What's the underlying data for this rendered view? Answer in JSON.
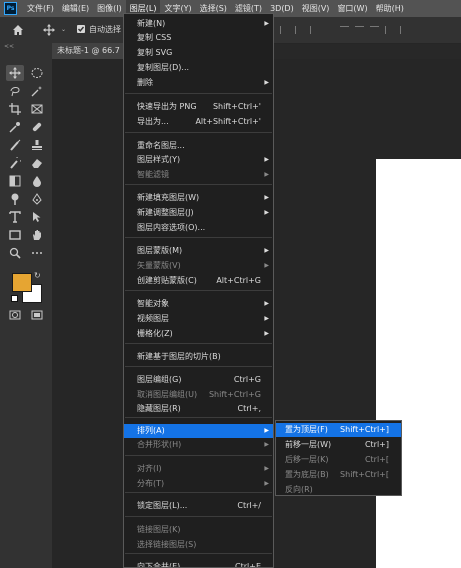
{
  "app": {
    "logo": "Ps"
  },
  "menubar": {
    "items": [
      "文件(F)",
      "编辑(E)",
      "图像(I)",
      "图层(L)",
      "文字(Y)",
      "选择(S)",
      "滤镜(T)",
      "3D(D)",
      "视图(V)",
      "窗口(W)",
      "帮助(H)"
    ]
  },
  "options_bar": {
    "auto_select_label": "自动选择",
    "collapse_glyph": "<<"
  },
  "document": {
    "tab_label": "未标题-1 @ 66.7"
  },
  "colors": {
    "foreground": "#e6a532",
    "background": "#ffffff",
    "highlight": "#1473e6"
  },
  "layer_menu": {
    "items": [
      {
        "label": "新建(N)",
        "submenu": true
      },
      {
        "label": "复制 CSS"
      },
      {
        "label": "复制 SVG"
      },
      {
        "label": "复制图层(D)..."
      },
      {
        "label": "删除",
        "submenu": true
      },
      {
        "label": "快速导出为 PNG",
        "shortcut": "Shift+Ctrl+'"
      },
      {
        "label": "导出为...",
        "shortcut": "Alt+Shift+Ctrl+'"
      },
      {
        "label": "重命名图层..."
      },
      {
        "label": "图层样式(Y)",
        "submenu": true
      },
      {
        "label": "智能滤镜",
        "submenu": true,
        "disabled": true
      },
      {
        "label": "新建填充图层(W)",
        "submenu": true
      },
      {
        "label": "新建调整图层(J)",
        "submenu": true
      },
      {
        "label": "图层内容选项(O)..."
      },
      {
        "label": "图层蒙版(M)",
        "submenu": true
      },
      {
        "label": "矢量蒙版(V)",
        "submenu": true,
        "disabled": true
      },
      {
        "label": "创建剪贴蒙版(C)",
        "shortcut": "Alt+Ctrl+G"
      },
      {
        "label": "智能对象",
        "submenu": true
      },
      {
        "label": "视频图层",
        "submenu": true
      },
      {
        "label": "栅格化(Z)",
        "submenu": true
      },
      {
        "label": "新建基于图层的切片(B)"
      },
      {
        "label": "图层编组(G)",
        "shortcut": "Ctrl+G"
      },
      {
        "label": "取消图层编组(U)",
        "shortcut": "Shift+Ctrl+G",
        "disabled": true
      },
      {
        "label": "隐藏图层(R)",
        "shortcut": "Ctrl+,"
      },
      {
        "label": "排列(A)",
        "submenu": true,
        "highlighted": true
      },
      {
        "label": "合并形状(H)",
        "submenu": true,
        "disabled": true
      },
      {
        "label": "对齐(I)",
        "submenu": true,
        "disabled": true
      },
      {
        "label": "分布(T)",
        "submenu": true,
        "disabled": true
      },
      {
        "label": "锁定图层(L)...",
        "shortcut": "Ctrl+/"
      },
      {
        "label": "链接图层(K)",
        "disabled": true
      },
      {
        "label": "选择链接图层(S)",
        "disabled": true
      },
      {
        "label": "向下合并(E)",
        "shortcut": "Ctrl+E"
      }
    ]
  },
  "arrange_submenu": {
    "items": [
      {
        "label": "置为顶层(F)",
        "shortcut": "Shift+Ctrl+]",
        "highlighted": true
      },
      {
        "label": "前移一层(W)",
        "shortcut": "Ctrl+]"
      },
      {
        "label": "后移一层(K)",
        "shortcut": "Ctrl+[",
        "disabled": true
      },
      {
        "label": "置为底层(B)",
        "shortcut": "Shift+Ctrl+[",
        "disabled": true
      },
      {
        "label": "反向(R)",
        "disabled": true
      }
    ]
  },
  "tools": [
    "move-tool-icon",
    "marquee-tool-icon",
    "lasso-tool-icon",
    "magic-wand-tool-icon",
    "crop-tool-icon",
    "frame-tool-icon",
    "eyedropper-tool-icon",
    "healing-brush-tool-icon",
    "brush-tool-icon",
    "clone-stamp-tool-icon",
    "history-brush-tool-icon",
    "eraser-tool-icon",
    "gradient-tool-icon",
    "blur-tool-icon",
    "dodge-tool-icon",
    "pen-tool-icon",
    "type-tool-icon",
    "path-selection-tool-icon",
    "rectangle-tool-icon",
    "hand-tool-icon",
    "zoom-tool-icon",
    "more-tools-icon",
    "quick-mask-icon",
    "screen-mode-icon"
  ]
}
